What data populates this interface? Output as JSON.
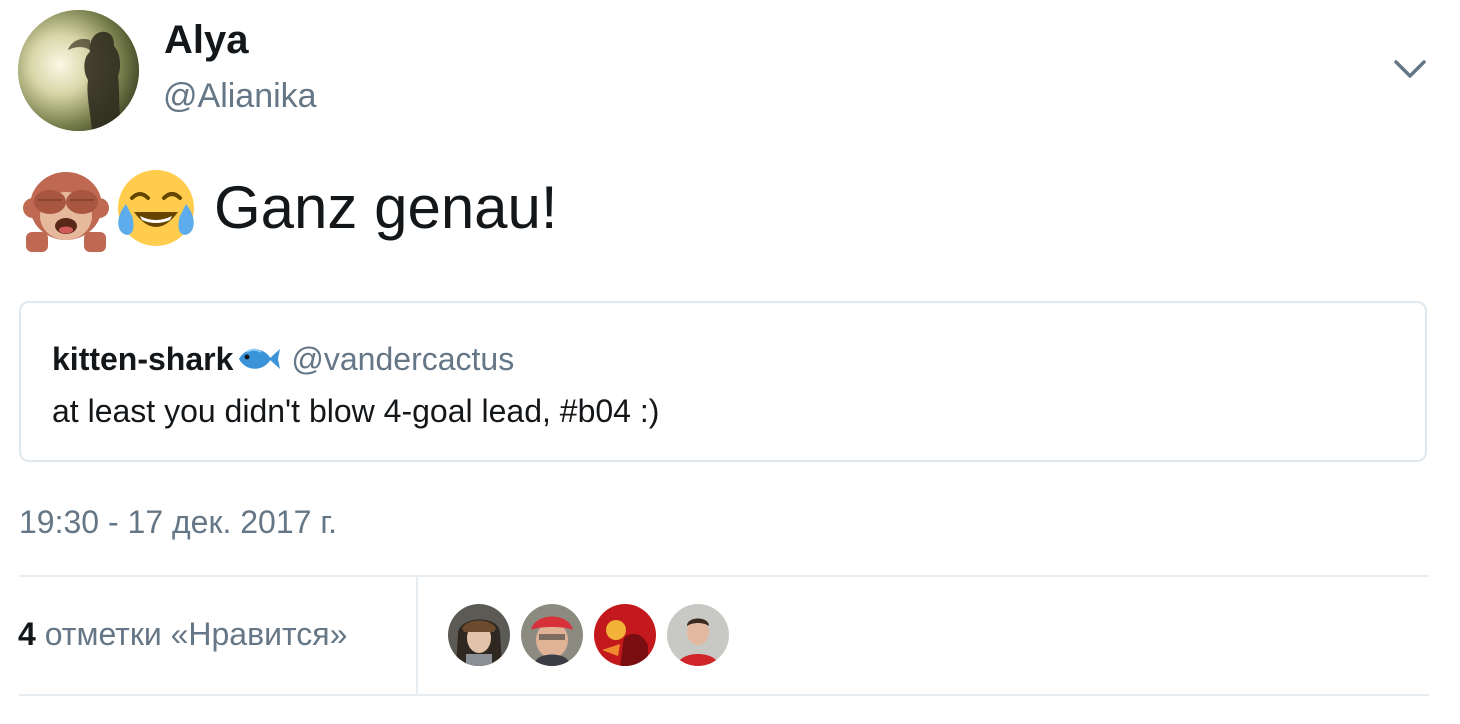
{
  "author": {
    "display_name": "Alya",
    "screen_name": "@Alianika",
    "avatar_icon": "profile-photo-silhouette"
  },
  "tweet": {
    "emojis": [
      "see-no-evil-monkey-emoji",
      "face-with-tears-of-joy-emoji"
    ],
    "text": "Ganz genau!"
  },
  "quoted_tweet": {
    "display_name": "kitten-shark",
    "name_emoji": "fish-emoji",
    "screen_name": "@vandercactus",
    "text": "at least you didn't blow 4-goal lead, #b04 :)"
  },
  "timestamp": "19:30 - 17 дек. 2017 г.",
  "stats": {
    "likes_count": "4",
    "likes_label": "отметки «Нравится»",
    "likers": [
      {
        "icon": "liker-avatar-1"
      },
      {
        "icon": "liker-avatar-2"
      },
      {
        "icon": "liker-avatar-3"
      },
      {
        "icon": "liker-avatar-4"
      }
    ]
  },
  "colors": {
    "text_primary": "#14171a",
    "text_secondary": "#657786",
    "border": "#e1e8ed"
  }
}
